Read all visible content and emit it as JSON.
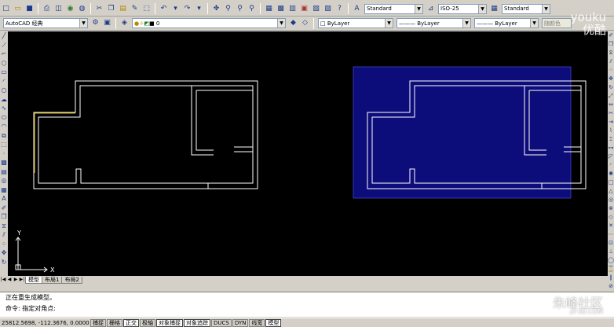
{
  "toolbar1": {
    "text_style": "Standard",
    "dim_style": "ISO-25",
    "table_style": "Standard"
  },
  "toolbar2": {
    "workspace": "AutoCAD 经典",
    "layer": "0",
    "color": "ByLayer",
    "linetype": "ByLayer",
    "lineweight": "ByLayer",
    "plotstyle": "随颜色"
  },
  "drawing": {
    "axis_x": "X",
    "axis_y": "Y",
    "selection_color": "#0c0c7a",
    "linework_color": "#ffffff"
  },
  "tabs": [
    "模型",
    "布局1",
    "布局2"
  ],
  "command": {
    "line1": "正在重生成模型。",
    "line2": "命令: 指定对角点:"
  },
  "status": {
    "coords": "25812.5698, -112.3676, 0.0000",
    "buttons": [
      "捕捉",
      "栅格",
      "正交",
      "极轴",
      "对象捕捉",
      "对象追踪",
      "DUCS",
      "DYN",
      "线宽",
      "模型"
    ]
  },
  "watermark": {
    "brand": "youku",
    "brand_sub": "优酷",
    "site": "朱峰社区",
    "site_url": "ZF3D.COM"
  }
}
